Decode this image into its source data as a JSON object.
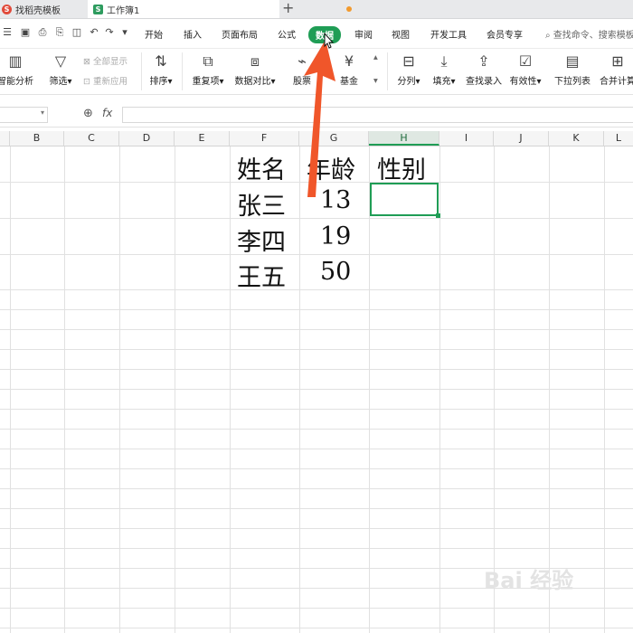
{
  "tabs": [
    {
      "label": "找稻壳模板",
      "icon": "docer-logo-icon"
    },
    {
      "label": "工作簿1",
      "icon": "spreadsheet-icon"
    }
  ],
  "menu": [
    "开始",
    "插入",
    "页面布局",
    "公式",
    "数据",
    "审阅",
    "视图",
    "开发工具",
    "会员专享"
  ],
  "active_menu": "数据",
  "search_placeholder": "查找命令、搜索模板",
  "ribbon": {
    "smart_analysis": "智能分析",
    "filter": "筛选",
    "show_all": "全部显示",
    "reapply": "重新应用",
    "sort": "排序",
    "duplicates": "重复项",
    "compare": "数据对比",
    "stock": "股票",
    "fund": "基金",
    "split": "分列",
    "fill": "填充",
    "lookup": "查找录入",
    "validity": "有效性",
    "dropdown": "下拉列表",
    "consolidate": "合并计算"
  },
  "formula_bar": {
    "fx": "fx",
    "value": ""
  },
  "columns": [
    "B",
    "C",
    "D",
    "E",
    "F",
    "G",
    "H",
    "I",
    "J",
    "K",
    "L"
  ],
  "selected_column": "H",
  "cells": {
    "header": {
      "name": "姓名",
      "age": "年龄",
      "gender": "性别"
    },
    "rows": [
      {
        "name": "张三",
        "age": "13"
      },
      {
        "name": "李四",
        "age": "19"
      },
      {
        "name": "王五",
        "age": "50"
      }
    ]
  },
  "watermark": "Bai 经验",
  "colors": {
    "accent": "#1f9d55",
    "arrow": "#f0562a"
  }
}
